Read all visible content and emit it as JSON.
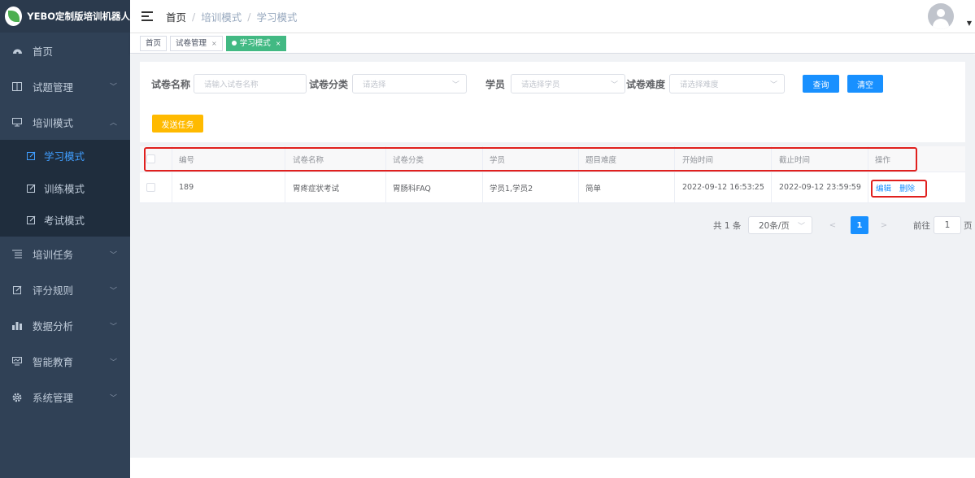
{
  "app": {
    "title": "YEBO定制版培训机器人"
  },
  "sidebar": {
    "items": [
      {
        "label": "首页",
        "icon": "dashboard-icon"
      },
      {
        "label": "试题管理",
        "icon": "book-icon"
      },
      {
        "label": "培训模式",
        "icon": "monitor-icon"
      },
      {
        "label": "培训任务",
        "icon": "list-icon"
      },
      {
        "label": "评分规则",
        "icon": "edit-icon"
      },
      {
        "label": "数据分析",
        "icon": "chart-icon"
      },
      {
        "label": "智能教育",
        "icon": "screen-icon"
      },
      {
        "label": "系统管理",
        "icon": "gear-icon"
      }
    ],
    "sub_items": [
      {
        "label": "学习模式",
        "icon": "edit-icon",
        "active": true
      },
      {
        "label": "训练模式",
        "icon": "edit-icon",
        "active": false
      },
      {
        "label": "考试模式",
        "icon": "edit-icon",
        "active": false
      }
    ]
  },
  "header": {
    "breadcrumbs": [
      "首页",
      "培训模式",
      "学习模式"
    ],
    "separator": "/"
  },
  "tags": [
    {
      "label": "首页",
      "closable": false
    },
    {
      "label": "试卷管理",
      "closable": true
    },
    {
      "label": "学习模式",
      "closable": true,
      "active": true
    }
  ],
  "tag_close": "×",
  "filters": {
    "paper_name": {
      "label": "试卷名称",
      "placeholder": "请输入试卷名称"
    },
    "paper_category": {
      "label": "试卷分类",
      "placeholder": "请选择"
    },
    "student": {
      "label": "学员",
      "placeholder": "请选择学员"
    },
    "difficulty": {
      "label": "试卷难度",
      "placeholder": "请选择难度"
    },
    "query_label": "查询",
    "clear_label": "清空",
    "send_task_label": "发送任务"
  },
  "table": {
    "columns": [
      "编号",
      "试卷名称",
      "试卷分类",
      "学员",
      "题目难度",
      "开始时间",
      "截止时间",
      "操作"
    ],
    "rows": [
      {
        "id": "189",
        "name": "胃疼症状考试",
        "category": "胃肠科FAQ",
        "students": "学员1,学员2",
        "difficulty": "简单",
        "start": "2022-09-12 16:53:25",
        "end": "2022-09-12 23:59:59",
        "edit_label": "编辑",
        "delete_label": "删除"
      }
    ]
  },
  "pagination": {
    "total_text": "共 1 条",
    "page_size": "20条/页",
    "prev": "<",
    "current_page": "1",
    "next": ">",
    "goto_label": "前往",
    "goto_value": "1",
    "goto_suffix": "页"
  },
  "colors": {
    "sidebar_bg": "#304156",
    "active_menu": "#409eff",
    "tag_active": "#42b983",
    "primary": "#1890ff",
    "warning": "#ffba00",
    "highlight_box": "#e0201e"
  }
}
